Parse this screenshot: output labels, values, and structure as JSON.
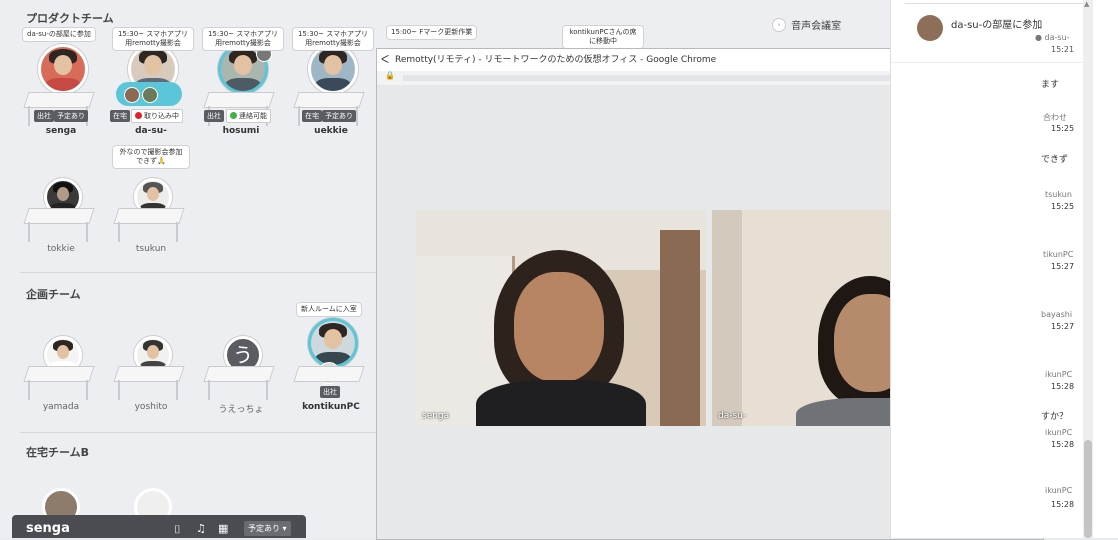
{
  "teams": [
    {
      "title": "プロダクトチーム"
    },
    {
      "title": "企画チーム"
    },
    {
      "title": "在宅チームB"
    }
  ],
  "voice_room": {
    "label": "音声会議室"
  },
  "product_seats": [
    {
      "name": "senga",
      "bubble": "da-su-の部屋に参加",
      "tag1": "出社",
      "tag2": "予定あり"
    },
    {
      "name": "da-su-",
      "bubble": "15:30~ スマホアプリ用remotty撮影会",
      "tag1": "在宅",
      "status": "取り込み中"
    },
    {
      "name": "hosumi",
      "bubble": "15:30~ スマホアプリ用remotty撮影会",
      "tag1": "出社",
      "status": "連絡可能"
    },
    {
      "name": "uekkie",
      "bubble": "15:30~ スマホアプリ用remotty撮影会",
      "tag1": "在宅",
      "tag2": "予定あり"
    },
    {
      "name": "tokkie"
    },
    {
      "name": "tsukun",
      "bubble": "外なので撮影会参加できず🙏"
    }
  ],
  "extra_bubbles": {
    "b5": "15:00~ Fマーク更新作業",
    "b6": "kontikunPCさんの席に移動中"
  },
  "planning_seats": [
    {
      "name": "yamada"
    },
    {
      "name": "yoshito"
    },
    {
      "name": "うえっちょ",
      "avatar_char": "う"
    },
    {
      "name": "kontikunPC",
      "bubble": "新人ルームに入室",
      "tag1": "出社"
    }
  ],
  "bottombar": {
    "user": "senga",
    "status": "予定あり"
  },
  "chrome": {
    "title": "Remotty(リモティ) - リモートワークのための仮想オフィス - Google Chrome",
    "participants": [
      {
        "name": "senga"
      },
      {
        "name": "da-su-"
      }
    ]
  },
  "sidebar": {
    "top_message": "da-su-の部屋に参加",
    "top_user": "da-su-",
    "top_time": "15:21",
    "items": [
      {
        "text": "ます",
        "user": "",
        "time": ""
      },
      {
        "text": "合わせ",
        "user": "",
        "time": "15:25"
      },
      {
        "text": "できず",
        "user": "tsukun",
        "time": "15:25"
      },
      {
        "text": "",
        "user": "tikunPC",
        "time": "15:27"
      },
      {
        "text": "",
        "user": "bayashi",
        "time": "15:27"
      },
      {
        "text": "",
        "user": "ikunPC",
        "time": "15:28"
      },
      {
        "text": "すか？",
        "user": "ikunPC",
        "time": "15:28"
      },
      {
        "text": "",
        "user": "ikunPC",
        "time": "15:28"
      }
    ]
  },
  "colors": {
    "accent": "#5ac6d8",
    "busy": "#e0242b",
    "available": "#3fb33f"
  }
}
